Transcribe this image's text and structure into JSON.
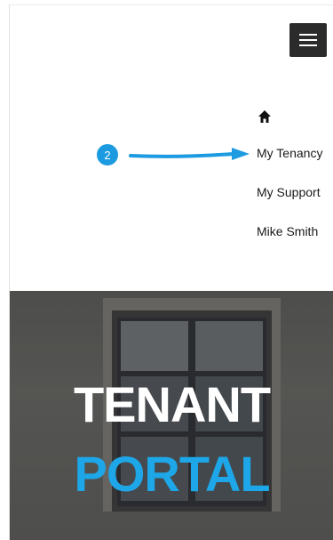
{
  "nav": {
    "home_icon": "home-icon",
    "items": [
      {
        "label": "My Tenancy"
      },
      {
        "label": "My Support"
      },
      {
        "label": "Mike Smith"
      }
    ]
  },
  "annotation": {
    "badge": "2",
    "color": "#1d9be0"
  },
  "hero": {
    "line1": "TENANT",
    "line2": "PORTAL",
    "line1_color": "#ffffff",
    "line2_color": "#1ea7e8"
  },
  "header": {
    "menu_icon": "hamburger-menu-icon"
  }
}
